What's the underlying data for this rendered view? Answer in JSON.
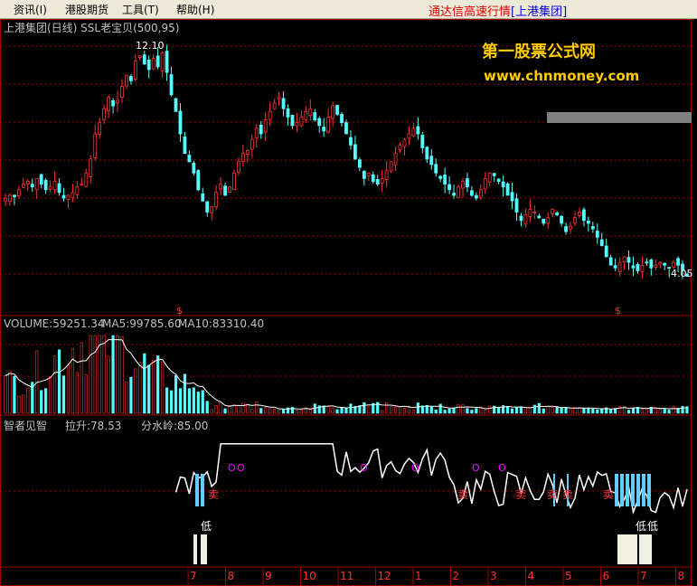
{
  "menu": [
    {
      "label": "资讯(I)"
    },
    {
      "label": "港股期货"
    },
    {
      "label": "工具(T)"
    },
    {
      "label": "帮助(H)"
    }
  ],
  "app_title_main": "通达信高速行情",
  "app_title_bracket": "[上港集团]",
  "price_panel": {
    "header": "上港集团(日线) SSL老宝贝(500,95)",
    "high_label": "12.10",
    "low_label": "4.05",
    "marker": "$",
    "watermark_line1": "第一股票公式网",
    "watermark_line2": "www.chnmoney.com"
  },
  "volume_panel": {
    "label": "VOLUME:59251.34",
    "ma5": "MA5:99785.60",
    "ma10": "MA10:83310.40"
  },
  "indicator_panel": {
    "name": "智者见智",
    "lift": "拉升:78.53",
    "watershed": "分水岭:85.00",
    "sell_label": "卖",
    "low_label": "低",
    "o_label": "O"
  },
  "date_axis": [
    "7",
    "8",
    "9",
    "10",
    "11",
    "12",
    "1",
    "2",
    "3",
    "4",
    "5",
    "6",
    "7",
    "8"
  ],
  "colors": {
    "up": "#ff3232",
    "down": "#54ffff",
    "grid": "#a00000",
    "ma_line": "#ffffff",
    "text_white": "#c0c0c0",
    "watermark": "#ffcc00",
    "magenta": "#ff00ff"
  },
  "chart_data": {
    "type": "candlestick",
    "price_range": [
      3.6,
      12.6
    ],
    "closes": [
      6.9,
      7.0,
      6.95,
      7.2,
      7.4,
      7.5,
      7.3,
      7.6,
      7.4,
      7.2,
      7.3,
      7.5,
      7.1,
      6.9,
      7.0,
      7.1,
      7.3,
      7.4,
      7.8,
      8.3,
      9.2,
      9.6,
      10.1,
      10.5,
      10.2,
      10.4,
      10.9,
      11.3,
      11.1,
      11.8,
      12.0,
      11.7,
      11.5,
      11.9,
      11.6,
      12.1,
      11.4,
      10.6,
      10.0,
      9.2,
      8.5,
      8.2,
      7.8,
      7.2,
      6.8,
      6.4,
      6.6,
      7.1,
      7.4,
      7.0,
      7.3,
      7.8,
      8.2,
      8.5,
      8.6,
      9.0,
      9.4,
      9.2,
      9.7,
      10.0,
      10.3,
      10.5,
      10.1,
      9.8,
      9.5,
      9.6,
      9.8,
      10.0,
      10.1,
      9.7,
      9.5,
      9.3,
      9.8,
      10.2,
      9.9,
      9.6,
      9.2,
      8.8,
      8.3,
      8.0,
      7.6,
      7.8,
      7.5,
      7.4,
      7.6,
      7.9,
      8.2,
      8.5,
      8.8,
      9.0,
      9.2,
      9.4,
      9.2,
      8.7,
      8.3,
      8.1,
      7.8,
      7.6,
      7.4,
      7.2,
      7.0,
      7.3,
      7.5,
      7.3,
      7.0,
      6.9,
      7.2,
      7.6,
      7.8,
      7.7,
      7.5,
      7.3,
      7.0,
      6.8,
      6.4,
      6.1,
      6.3,
      6.5,
      6.4,
      6.2,
      6.0,
      6.2,
      6.5,
      6.3,
      6.0,
      5.7,
      5.9,
      6.2,
      6.4,
      6.1,
      6.0,
      5.8,
      5.5,
      5.2,
      4.8,
      4.5,
      4.4,
      4.6,
      4.8,
      4.6,
      4.4,
      4.3,
      4.5,
      4.6,
      4.4,
      4.5,
      4.6,
      4.5,
      4.4,
      4.6,
      4.5,
      4.3,
      4.1
    ]
  }
}
